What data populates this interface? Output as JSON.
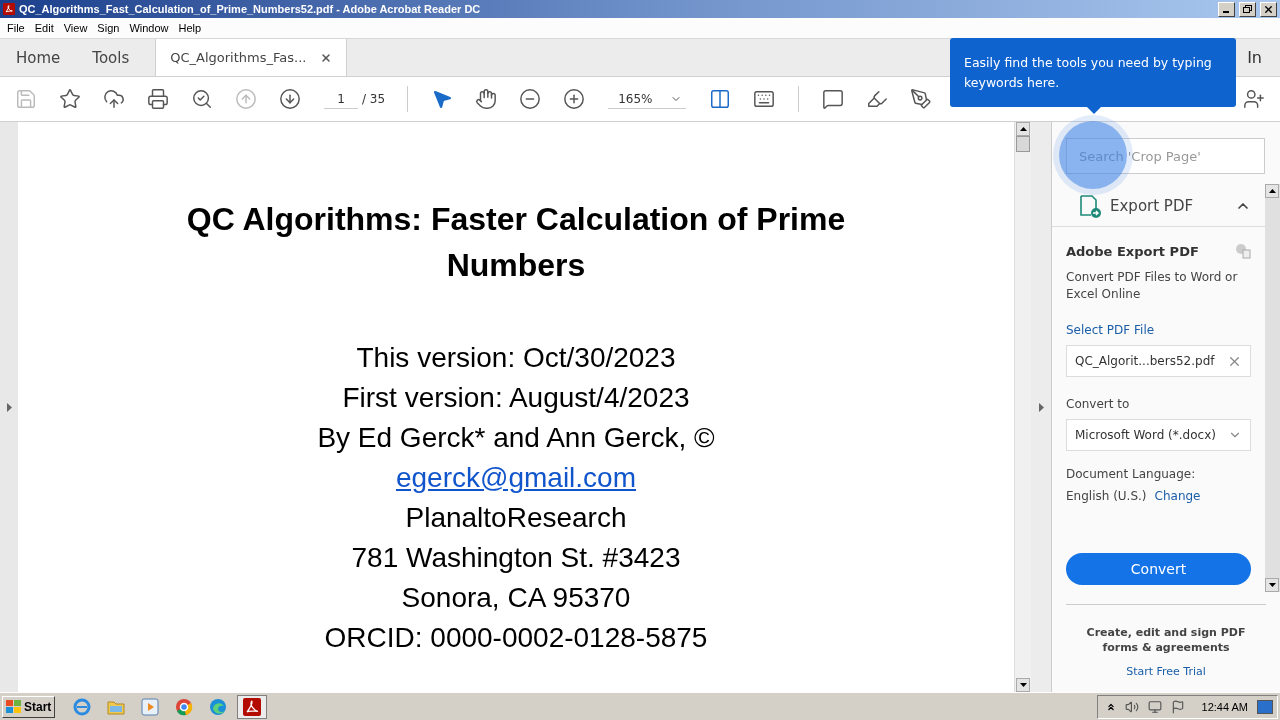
{
  "window": {
    "title": "QC_Algorithms_Fast_Calculation_of_Prime_Numbers52.pdf - Adobe Acrobat Reader DC"
  },
  "menu": [
    "File",
    "Edit",
    "View",
    "Sign",
    "Window",
    "Help"
  ],
  "tabs": [
    {
      "label": "Home",
      "selected": false,
      "closable": false
    },
    {
      "label": "Tools",
      "selected": false,
      "closable": false
    },
    {
      "label": "QC_Algorithms_Fas...",
      "selected": true,
      "closable": true
    }
  ],
  "sign_in": "In",
  "toolbar": {
    "left": [
      {
        "kind": "save",
        "disabled": true
      },
      {
        "kind": "star",
        "disabled": false
      },
      {
        "kind": "upload",
        "disabled": false
      },
      {
        "kind": "print",
        "disabled": false
      },
      {
        "kind": "find",
        "disabled": false
      },
      {
        "kind": "prev",
        "disabled": true
      },
      {
        "kind": "next",
        "disabled": false
      }
    ],
    "page_number": "1",
    "page_total": "/ 35",
    "middle": [
      {
        "kind": "select",
        "selected": true
      },
      {
        "kind": "hand",
        "selected": false
      },
      {
        "kind": "zoom-out",
        "selected": false
      },
      {
        "kind": "zoom-in",
        "selected": false
      }
    ],
    "zoom": "165%",
    "right": [
      {
        "kind": "fit"
      },
      {
        "kind": "scroll"
      },
      {
        "kind": "comment"
      },
      {
        "kind": "highlight"
      },
      {
        "kind": "sign"
      },
      {
        "kind": "share"
      }
    ]
  },
  "tooltip": "Easily find the tools you need by typing keywords here.",
  "document": {
    "title": "QC Algorithms: Faster Calculation of Prime Numbers",
    "lines": [
      {
        "kind": "text",
        "text": "This version: Oct/30/2023"
      },
      {
        "kind": "text",
        "text": "First version: August/4/2023"
      },
      {
        "kind": "text",
        "text": "By Ed Gerck* and Ann Gerck, ©"
      },
      {
        "kind": "link",
        "text": "egerck@gmail.com"
      },
      {
        "kind": "text",
        "text": "PlanaltoResearch"
      },
      {
        "kind": "text",
        "text": "781 Washington St. #3423"
      },
      {
        "kind": "text",
        "text": "Sonora, CA 95370"
      },
      {
        "kind": "text",
        "text": "ORCID: 0000-0002-0128-5875"
      }
    ]
  },
  "panel": {
    "search_placeholder": "Search 'Crop Page'",
    "section": {
      "title": "Export PDF",
      "expanded": true
    },
    "heading": "Adobe Export PDF",
    "description": "Convert PDF Files to Word or Excel Online",
    "select_label": "Select PDF File",
    "file": "QC_Algorit...bers52.pdf",
    "convert_label": "Convert to",
    "convert_value": "Microsoft Word (*.docx)",
    "language_label": "Document Language:",
    "language_value": "English (U.S.)",
    "change_link": "Change",
    "convert_button": "Convert",
    "promo": "Create, edit and sign PDF forms & agreements",
    "trial_link": "Start Free Trial"
  },
  "taskbar": {
    "start": "Start",
    "apps": [
      {
        "kind": "ie",
        "selected": false
      },
      {
        "kind": "folder",
        "selected": false
      },
      {
        "kind": "media",
        "selected": false
      },
      {
        "kind": "chrome",
        "selected": false
      },
      {
        "kind": "edge",
        "selected": false
      },
      {
        "kind": "acrobat",
        "selected": true
      }
    ],
    "clock": "12:44 AM"
  }
}
